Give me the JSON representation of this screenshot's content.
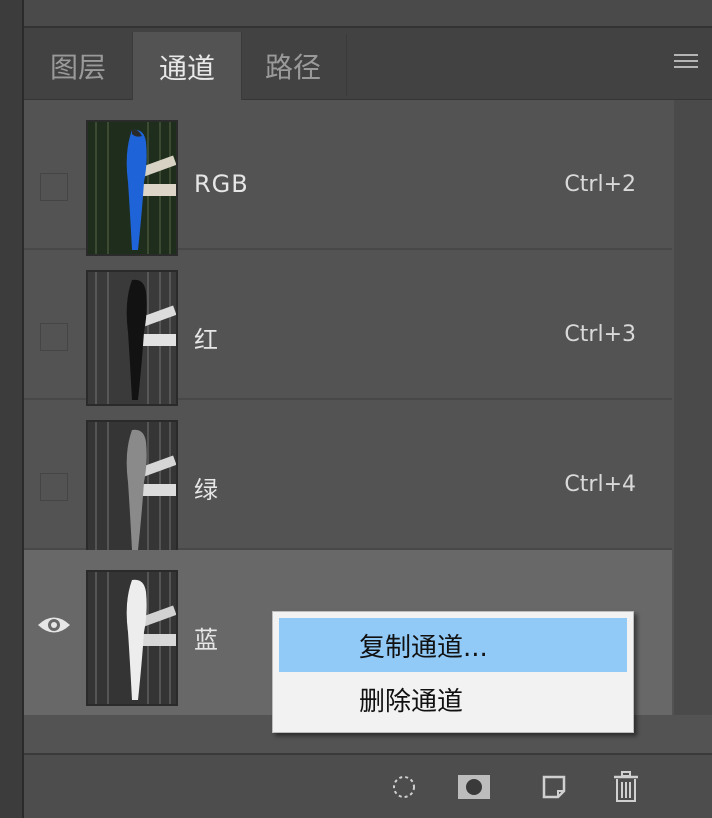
{
  "tabs": [
    {
      "label": "图层",
      "active": false
    },
    {
      "label": "通道",
      "active": true
    },
    {
      "label": "路径",
      "active": false
    }
  ],
  "channels": [
    {
      "name": "RGB",
      "shortcut": "Ctrl+2",
      "visible": false,
      "selected": false
    },
    {
      "name": "红",
      "shortcut": "Ctrl+3",
      "visible": false,
      "selected": false
    },
    {
      "name": "绿",
      "shortcut": "Ctrl+4",
      "visible": false,
      "selected": false
    },
    {
      "name": "蓝",
      "shortcut": "",
      "visible": true,
      "selected": true
    }
  ],
  "context_menu": {
    "items": [
      {
        "label": "复制通道...",
        "highlighted": true
      },
      {
        "label": "删除通道",
        "highlighted": false
      }
    ]
  },
  "bottom_tools": [
    {
      "icon": "dotted-circle-icon"
    },
    {
      "icon": "mask-icon"
    },
    {
      "icon": "new-channel-icon"
    },
    {
      "icon": "trash-icon"
    }
  ],
  "colors": {
    "panel": "#535353",
    "selected_row": "#686868",
    "menu_highlight": "#91c9f7"
  }
}
